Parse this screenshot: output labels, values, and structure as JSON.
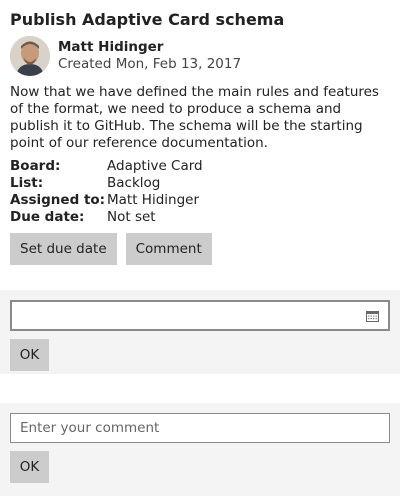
{
  "card": {
    "title": "Publish Adaptive Card schema",
    "author_name": "Matt Hidinger",
    "created": "Created Mon, Feb 13, 2017",
    "description": "Now that we have defined the main rules and features of the format, we need to produce a schema and publish it to GitHub. The schema will be the starting point of our reference documentation.",
    "facts": [
      {
        "key": "Board:",
        "value": "Adaptive Card"
      },
      {
        "key": "List:",
        "value": "Backlog"
      },
      {
        "key": "Assigned to:",
        "value": "Matt Hidinger"
      },
      {
        "key": "Due date:",
        "value": "Not set"
      }
    ],
    "actions": {
      "set_due_date": "Set due date",
      "comment": "Comment"
    }
  },
  "due_date_panel": {
    "value": "",
    "icon": "calendar-icon",
    "ok_label": "OK"
  },
  "comment_panel": {
    "placeholder": "Enter your comment",
    "ok_label": "OK"
  }
}
